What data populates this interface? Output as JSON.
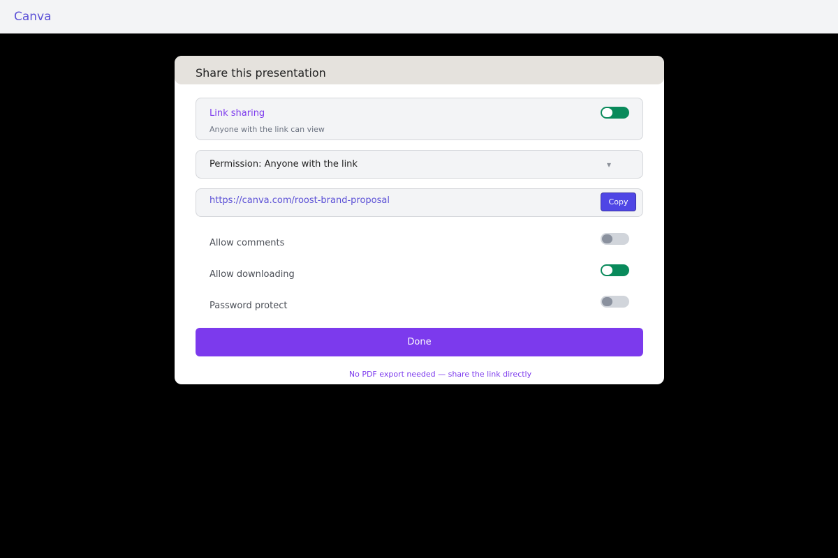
{
  "app": {
    "logo": "Canva"
  },
  "dialog": {
    "title": "Share this presentation",
    "link_sharing": {
      "title": "Link sharing",
      "subtitle": "Anyone with the link can view",
      "enabled": true
    },
    "permission": {
      "label": "Permission: Anyone with the link",
      "chevron": "▾"
    },
    "share_url": {
      "value": "https://canva.com/roost-brand-proposal",
      "copy_label": "Copy"
    },
    "options": [
      {
        "label": "Allow comments",
        "enabled": false
      },
      {
        "label": "Allow downloading",
        "enabled": true
      },
      {
        "label": "Password protect",
        "enabled": false
      }
    ],
    "done_label": "Done",
    "footnote": "No PDF export needed — share the link directly"
  },
  "colors": {
    "accent": "#7c3aed",
    "brand": "#5b50d6",
    "toggle_on": "#098a5b",
    "toggle_off": "#d1d5db",
    "copy_button": "#4f46e5"
  },
  "icons": {
    "permission_dropdown": "chevron-down-icon"
  }
}
